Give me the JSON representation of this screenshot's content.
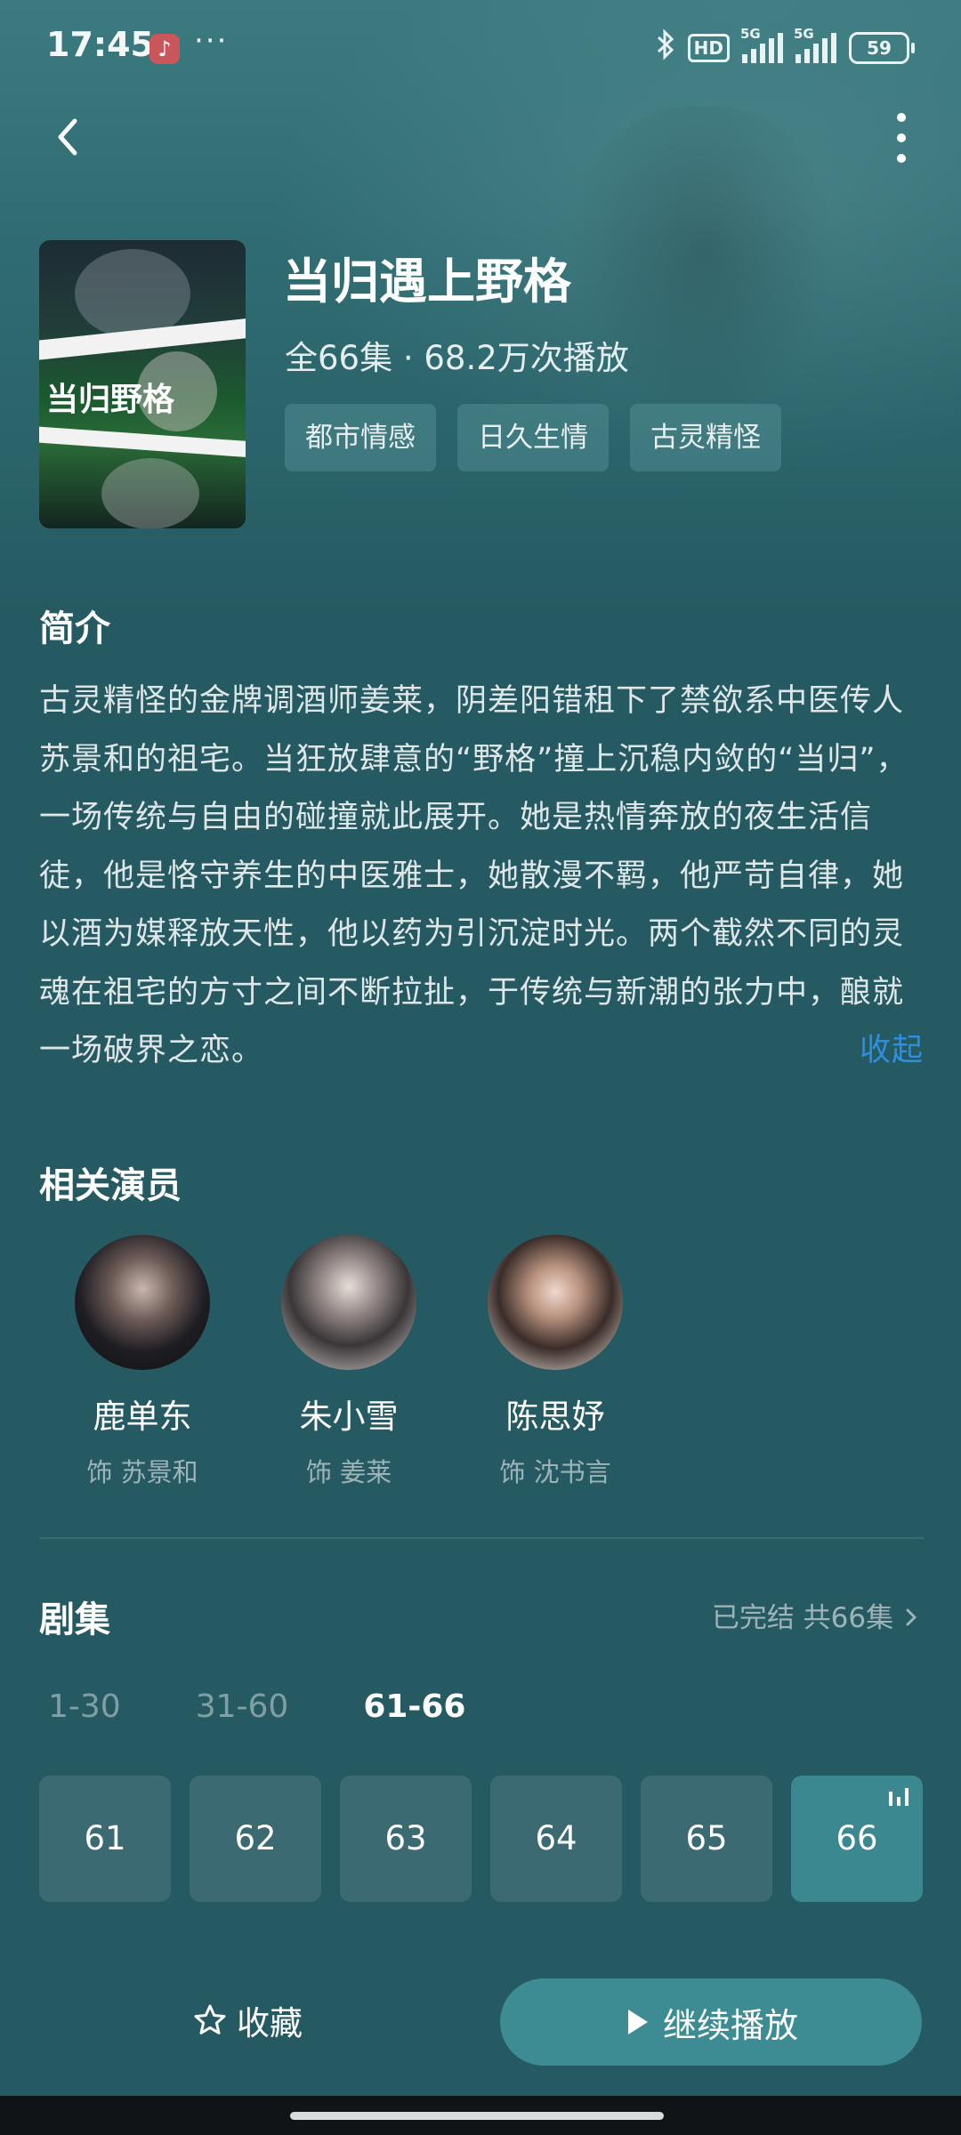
{
  "status_bar": {
    "time": "17:45",
    "dots": "···",
    "hd_label": "HD",
    "signal_label_1": "5G",
    "signal_label_2": "5G",
    "battery": "59",
    "icons": [
      "music-note-icon",
      "bluetooth-icon",
      "hd-icon",
      "signal-icon",
      "battery-icon"
    ]
  },
  "header": {
    "back_icon": "chevron-left-icon",
    "more_icon": "more-vertical-icon"
  },
  "drama": {
    "poster_title": "当归野格",
    "title": "当归遇上野格",
    "meta": "全66集 · 68.2万次播放",
    "tags": [
      "都市情感",
      "日久生情",
      "古灵精怪"
    ]
  },
  "synopsis": {
    "heading": "简介",
    "text": "古灵精怪的金牌调酒师姜莱，阴差阳错租下了禁欲系中医传人苏景和的祖宅。当狂放肆意的“野格”撞上沉稳内敛的“当归”，一场传统与自由的碰撞就此展开。她是热情奔放的夜生活信徒，他是恪守养生的中医雅士，她散漫不羁，他严苛自律，她以酒为媒释放天性，他以药为引沉淀时光。两个截然不同的灵魂在祖宅的方寸之间不断拉扯，于传统与新潮的张力中，酿就一场破界之恋。",
    "collapse_label": "收起"
  },
  "actors": {
    "heading": "相关演员",
    "items": [
      {
        "name": "鹿单东",
        "role": "饰 苏景和"
      },
      {
        "name": "朱小雪",
        "role": "饰 姜莱"
      },
      {
        "name": "陈思妤",
        "role": "饰 沈书言"
      }
    ]
  },
  "episodes": {
    "heading": "剧集",
    "status": "已完结 共66集",
    "chevron_icon": "chevron-right-icon",
    "ranges": [
      "1-30",
      "31-60",
      "61-66"
    ],
    "active_range": "61-66",
    "items": [
      "61",
      "62",
      "63",
      "64",
      "65",
      "66"
    ],
    "current": "66",
    "playing_icon": "equalizer-icon"
  },
  "actions": {
    "favorite_label": "收藏",
    "favorite_icon": "star-outline-icon",
    "play_label": "继续播放",
    "play_icon": "play-icon",
    "accent_color": "#3d8c93",
    "link_color": "#2d8fe0"
  }
}
